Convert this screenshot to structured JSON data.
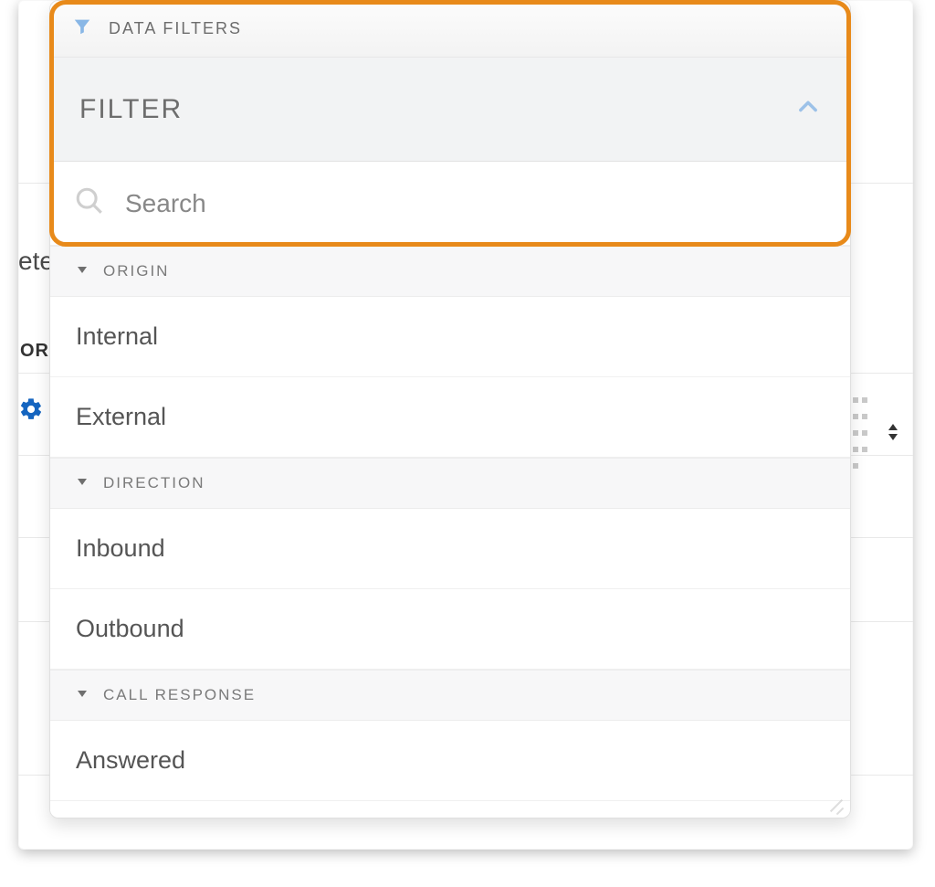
{
  "background": {
    "text_fragment_left": "ete",
    "column_header_fragment": "OR"
  },
  "panel": {
    "title": "DATA FILTERS",
    "subtitle": "FILTER",
    "search_placeholder": "Search",
    "groups": [
      {
        "label": "ORIGIN",
        "options": [
          {
            "label": "Internal"
          },
          {
            "label": "External"
          }
        ]
      },
      {
        "label": "DIRECTION",
        "options": [
          {
            "label": "Inbound"
          },
          {
            "label": "Outbound"
          }
        ]
      },
      {
        "label": "CALL RESPONSE",
        "options": [
          {
            "label": "Answered"
          }
        ]
      }
    ]
  },
  "colors": {
    "highlight_border": "#e88a1a",
    "icon_blue": "#89b7e6"
  }
}
